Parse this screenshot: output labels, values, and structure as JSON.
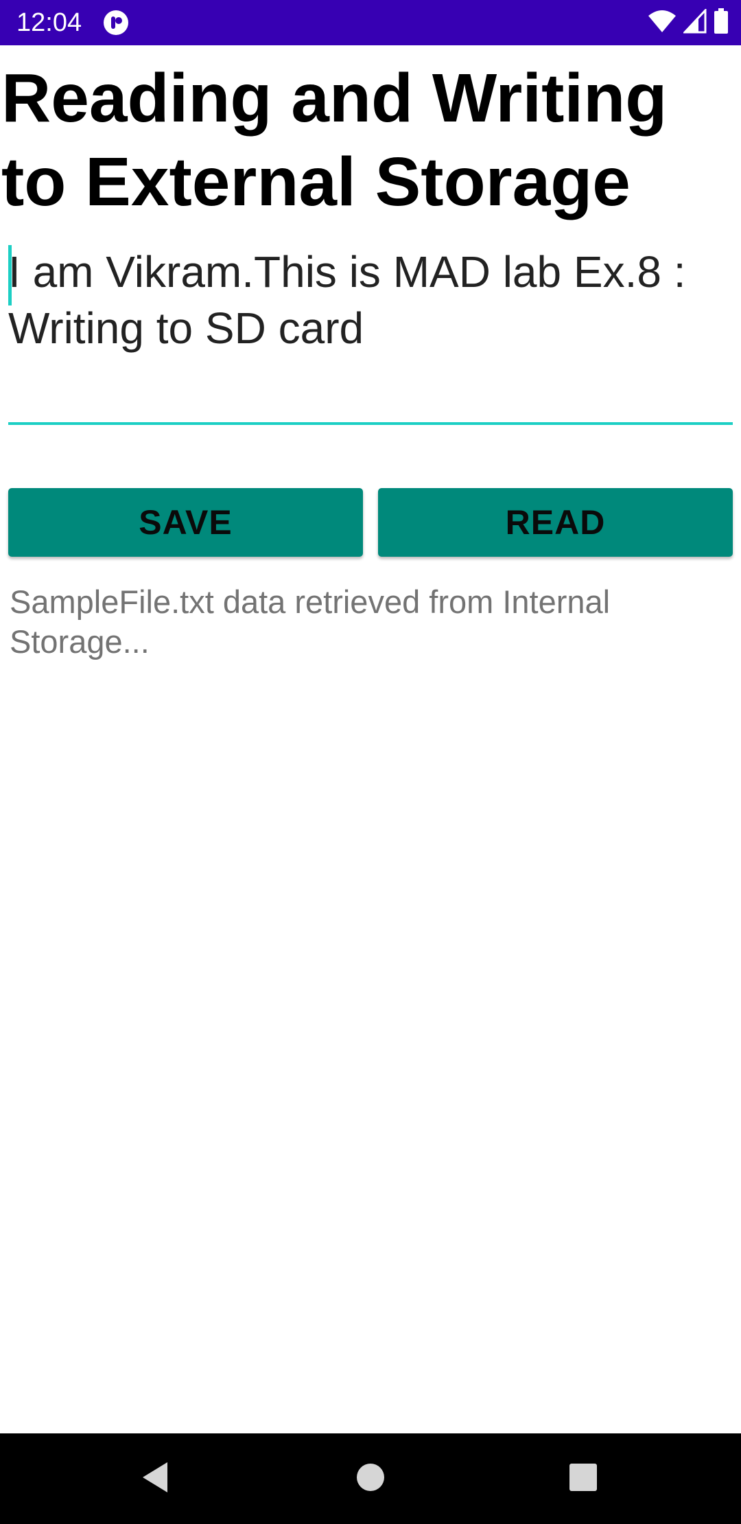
{
  "status_bar": {
    "time": "12:04",
    "background_color": "#3700B3",
    "icons": [
      "app-notification-icon",
      "wifi-icon",
      "cellular-signal-icon",
      "battery-icon"
    ]
  },
  "app": {
    "title": "Reading and Writing to External Storage",
    "input_value": "I am Vikram.This is MAD lab Ex.8 : Writing to SD card",
    "save_label": "SAVE",
    "read_label": "READ",
    "result_text": "SampleFile.txt data retrieved from Internal Storage...",
    "accent_color": "#1ccfc4",
    "button_color": "#00897B"
  },
  "nav_bar": {
    "icons": [
      "back-icon",
      "home-icon",
      "recents-icon"
    ]
  }
}
